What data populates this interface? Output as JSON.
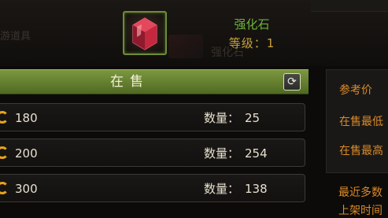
{
  "background": {
    "ghost_left_text": "游道具",
    "ghost_mid_text": "强化石"
  },
  "item": {
    "icon": "red-gem-icon",
    "name": "强化石",
    "level": "等级：1"
  },
  "sale": {
    "title": "在售",
    "refresh_icon": "refresh-icon"
  },
  "listings": [
    {
      "price": "180",
      "qty_label": "数量：",
      "qty": "25"
    },
    {
      "price": "200",
      "qty_label": "数量：",
      "qty": "254"
    },
    {
      "price": "300",
      "qty_label": "数量：",
      "qty": "138"
    }
  ],
  "reference": {
    "title": "参考价",
    "lowest": "在售最低",
    "highest": "在售最高"
  },
  "history": {
    "recent": "最近多数",
    "listing_time": "上架时间"
  },
  "colors": {
    "accent_green": "#7c9740",
    "item_name": "#6fb23a",
    "level": "#c8a13c",
    "coin": "#e9a31a",
    "orange_text": "#d98a2a"
  }
}
